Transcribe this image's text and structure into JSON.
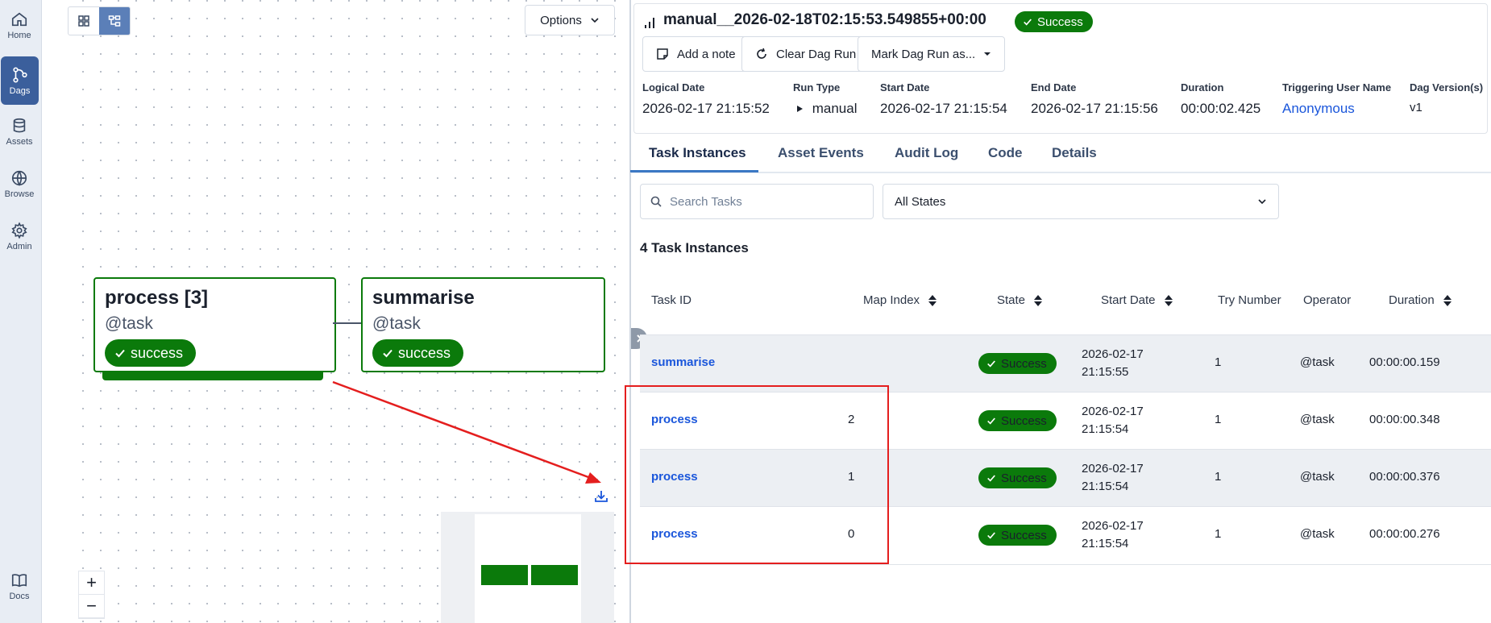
{
  "nav": {
    "items": [
      {
        "label": "Home",
        "icon": "home-icon"
      },
      {
        "label": "Dags",
        "icon": "dags-icon",
        "active": true
      },
      {
        "label": "Assets",
        "icon": "assets-icon"
      },
      {
        "label": "Browse",
        "icon": "browse-icon"
      },
      {
        "label": "Admin",
        "icon": "admin-icon"
      },
      {
        "label": "Docs",
        "icon": "docs-icon"
      }
    ]
  },
  "graph": {
    "options_label": "Options",
    "nodes": [
      {
        "title": "process [3]",
        "subtitle": "@task",
        "state": "success"
      },
      {
        "title": "summarise",
        "subtitle": "@task",
        "state": "success"
      }
    ],
    "zoom_in": "+",
    "zoom_out": "−"
  },
  "run": {
    "title": "manual__2026-02-18T02:15:53.549855+00:00",
    "state": "Success",
    "buttons": {
      "add_note": "Add a note",
      "clear": "Clear Dag Run",
      "mark": "Mark Dag Run as..."
    },
    "meta": [
      {
        "label": "Logical Date",
        "value": "2026-02-17 21:15:52"
      },
      {
        "label": "Run Type",
        "value": "manual"
      },
      {
        "label": "Start Date",
        "value": "2026-02-17 21:15:54"
      },
      {
        "label": "End Date",
        "value": "2026-02-17 21:15:56"
      },
      {
        "label": "Duration",
        "value": "00:00:02.425"
      },
      {
        "label": "Triggering User Name",
        "value": "Anonymous"
      },
      {
        "label": "Dag Version(s)",
        "value": "v1"
      }
    ]
  },
  "tabs": [
    "Task Instances",
    "Asset Events",
    "Audit Log",
    "Code",
    "Details"
  ],
  "filters": {
    "search_placeholder": "Search Tasks",
    "state_select": "All States"
  },
  "table": {
    "count_label": "4 Task Instances",
    "headers": [
      "Task ID",
      "Map Index",
      "State",
      "Start Date",
      "Try Number",
      "Operator",
      "Duration"
    ],
    "rows": [
      {
        "task": "summarise",
        "map_index": "",
        "state": "Success",
        "start_date_line1": "2026-02-17",
        "start_date_line2": "21:15:55",
        "try": "1",
        "operator": "@task",
        "duration": "00:00:00.159"
      },
      {
        "task": "process",
        "map_index": "2",
        "state": "Success",
        "start_date_line1": "2026-02-17",
        "start_date_line2": "21:15:54",
        "try": "1",
        "operator": "@task",
        "duration": "00:00:00.348"
      },
      {
        "task": "process",
        "map_index": "1",
        "state": "Success",
        "start_date_line1": "2026-02-17",
        "start_date_line2": "21:15:54",
        "try": "1",
        "operator": "@task",
        "duration": "00:00:00.376"
      },
      {
        "task": "process",
        "map_index": "0",
        "state": "Success",
        "start_date_line1": "2026-02-17",
        "start_date_line2": "21:15:54",
        "try": "1",
        "operator": "@task",
        "duration": "00:00:00.276"
      }
    ]
  },
  "colors": {
    "success": "#0b7a0b",
    "link": "#1a56db",
    "annotation": "#e41e1e",
    "nav_active": "#3b5f9c"
  }
}
